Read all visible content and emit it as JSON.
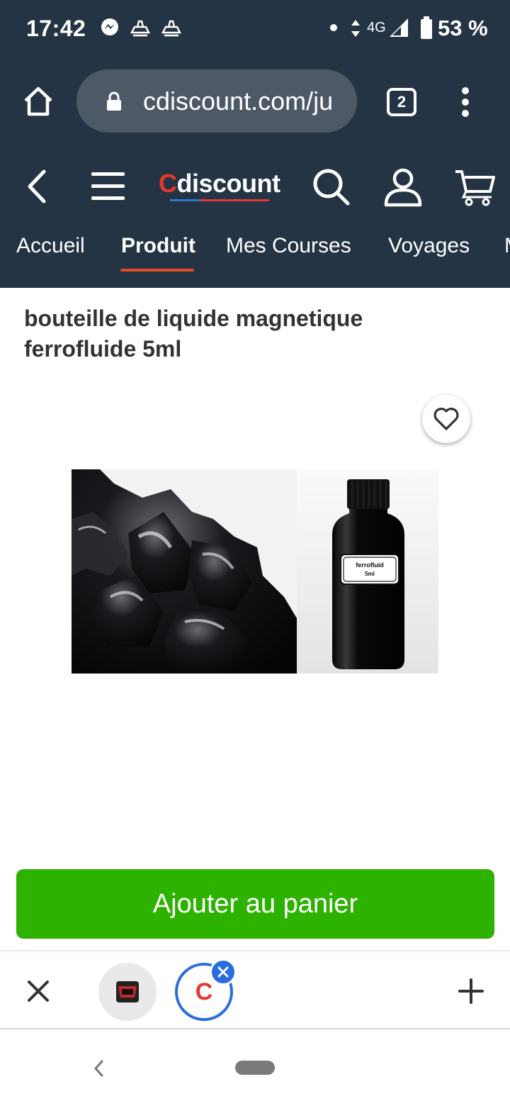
{
  "status_bar": {
    "time": "17:42",
    "network": "4G",
    "battery": "53 %",
    "icons": [
      "messenger-icon",
      "notification-icon",
      "notification-icon",
      "dot-icon",
      "data-arrows-icon",
      "signal-icon",
      "battery-icon"
    ]
  },
  "browser": {
    "url": "cdiscount.com/ju",
    "tab_count": "2",
    "icons": [
      "home-icon",
      "lock-icon",
      "tabs-icon",
      "more-menu-icon"
    ]
  },
  "site": {
    "logo_c": "C",
    "logo_rest": "discount",
    "icons": [
      "back-icon",
      "menu-icon",
      "search-icon",
      "account-icon",
      "cart-icon"
    ],
    "nav": [
      {
        "label": "Accueil",
        "active": false
      },
      {
        "label": "Produit",
        "active": true
      },
      {
        "label": "Mes Courses",
        "active": false
      },
      {
        "label": "Voyages",
        "active": false
      },
      {
        "label": "M",
        "active": false
      }
    ],
    "accent": "#e24a2a"
  },
  "product": {
    "title": "bouteille de liquide magnetique ferrofluide 5ml",
    "image_label_line1": "ferrofluid",
    "image_label_line2": "5ml",
    "favorite_icon": "heart-icon"
  },
  "cart": {
    "button_label": "Ajouter au panier",
    "button_color": "#2db200"
  },
  "tab_switcher": {
    "close_icon": "close-icon",
    "new_tab_icon": "plus-icon",
    "active_tab_letter": "C",
    "active_tab_color": "#2a6de0"
  },
  "colors": {
    "header_bg": "#243444",
    "url_pill_bg": "#4d5965"
  }
}
